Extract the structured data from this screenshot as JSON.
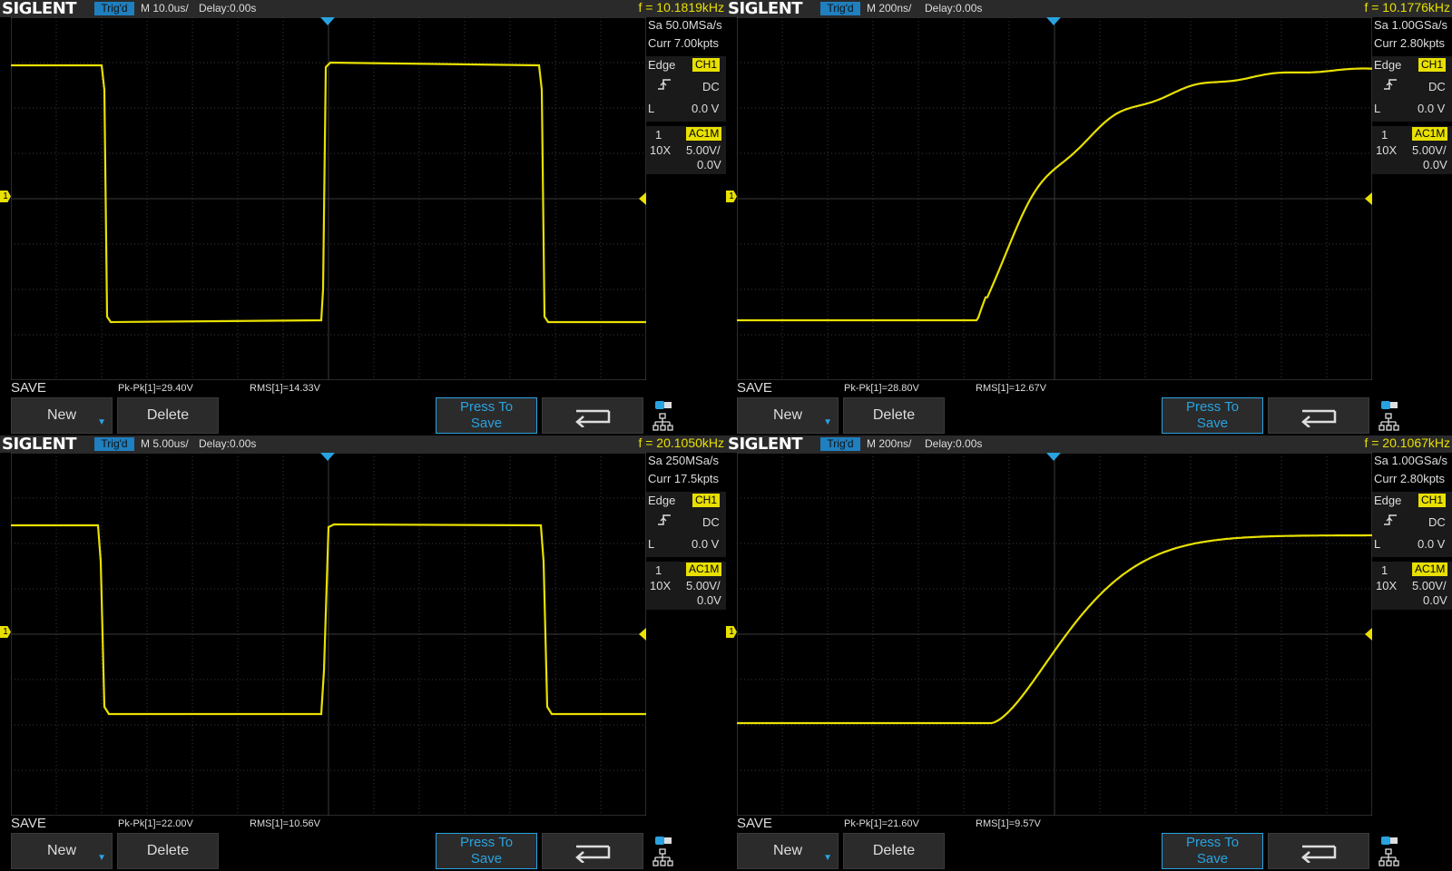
{
  "panels": [
    {
      "logo": "SIGLENT",
      "trig_status": "Trig'd",
      "timebase": "M 10.0us/",
      "delay": "Delay:0.00s",
      "frequency": "f = 10.1819kHz",
      "sample_rate": "Sa 50.0MSa/s",
      "curr_points": "Curr 7.00kpts",
      "trigger": {
        "type": "Edge",
        "source": "CH1",
        "coupling": "DC",
        "level_label": "L",
        "level": "0.0 V"
      },
      "channel": {
        "number": "1",
        "coupling": "AC1M",
        "probe": "10X",
        "scale": "5.00V/",
        "offset": "0.0V"
      },
      "save_label": "SAVE",
      "measurements": {
        "pkpk": "Pk-Pk[1]=29.40V",
        "rms": "RMS[1]=14.33V"
      },
      "buttons": {
        "new": "New",
        "delete": "Delete",
        "press_to": "Press To",
        "save": "Save"
      },
      "marker_label": "1",
      "waveform": "square10"
    },
    {
      "logo": "SIGLENT",
      "trig_status": "Trig'd",
      "timebase": "M 200ns/",
      "delay": "Delay:0.00s",
      "frequency": "f = 10.1776kHz",
      "sample_rate": "Sa 1.00GSa/s",
      "curr_points": "Curr 2.80kpts",
      "trigger": {
        "type": "Edge",
        "source": "CH1",
        "coupling": "DC",
        "level_label": "L",
        "level": "0.0 V"
      },
      "channel": {
        "number": "1",
        "coupling": "AC1M",
        "probe": "10X",
        "scale": "5.00V/",
        "offset": "0.0V"
      },
      "save_label": "SAVE",
      "measurements": {
        "pkpk": "Pk-Pk[1]=28.80V",
        "rms": "RMS[1]=12.67V"
      },
      "buttons": {
        "new": "New",
        "delete": "Delete",
        "press_to": "Press To",
        "save": "Save"
      },
      "marker_label": "1",
      "waveform": "rise_ringing"
    },
    {
      "logo": "SIGLENT",
      "trig_status": "Trig'd",
      "timebase": "M 5.00us/",
      "delay": "Delay:0.00s",
      "frequency": "f = 20.1050kHz",
      "sample_rate": "Sa 250MSa/s",
      "curr_points": "Curr 17.5kpts",
      "trigger": {
        "type": "Edge",
        "source": "CH1",
        "coupling": "DC",
        "level_label": "L",
        "level": "0.0 V"
      },
      "channel": {
        "number": "1",
        "coupling": "AC1M",
        "probe": "10X",
        "scale": "5.00V/",
        "offset": "0.0V"
      },
      "save_label": "SAVE",
      "measurements": {
        "pkpk": "Pk-Pk[1]=22.00V",
        "rms": "RMS[1]=10.56V"
      },
      "buttons": {
        "new": "New",
        "delete": "Delete",
        "press_to": "Press To",
        "save": "Save"
      },
      "marker_label": "1",
      "waveform": "square20"
    },
    {
      "logo": "SIGLENT",
      "trig_status": "Trig'd",
      "timebase": "M 200ns/",
      "delay": "Delay:0.00s",
      "frequency": "f = 20.1067kHz",
      "sample_rate": "Sa 1.00GSa/s",
      "curr_points": "Curr 2.80kpts",
      "trigger": {
        "type": "Edge",
        "source": "CH1",
        "coupling": "DC",
        "level_label": "L",
        "level": "0.0 V"
      },
      "channel": {
        "number": "1",
        "coupling": "AC1M",
        "probe": "10X",
        "scale": "5.00V/",
        "offset": "0.0V"
      },
      "save_label": "SAVE",
      "measurements": {
        "pkpk": "Pk-Pk[1]=21.60V",
        "rms": "RMS[1]=9.57V"
      },
      "buttons": {
        "new": "New",
        "delete": "Delete",
        "press_to": "Press To",
        "save": "Save"
      },
      "marker_label": "1",
      "waveform": "rise_smooth"
    }
  ],
  "colors": {
    "trace": "#e8e000",
    "accent": "#29a3e0",
    "grid": "#3a3a3a",
    "background": "#000000"
  },
  "icons": [
    "usb-icon",
    "network-icon",
    "back-arrow-icon",
    "trigger-edge-icon"
  ]
}
